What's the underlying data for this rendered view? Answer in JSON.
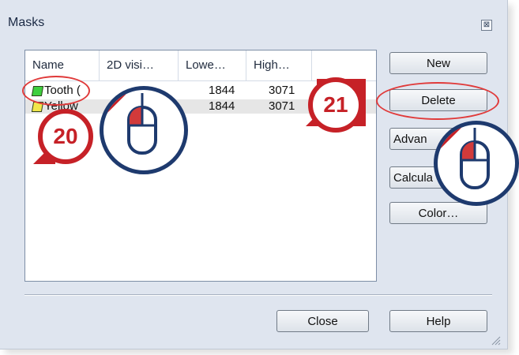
{
  "dialog": {
    "title": "Masks",
    "close_glyph": "⊠"
  },
  "table": {
    "headers": [
      "Name",
      "2D visi…",
      "Lowe…",
      "High…"
    ],
    "rows": [
      {
        "name": "Tooth (",
        "color": "#3ecf3e",
        "lower": "1844",
        "higher": "3071"
      },
      {
        "name": "Yellow",
        "color": "#f1e64a",
        "lower": "1844",
        "higher": "3071"
      }
    ]
  },
  "buttons": {
    "new": "New",
    "delete": "Delete",
    "advanced": "Advan",
    "calculate": "Calcula",
    "color": "Color…",
    "close": "Close",
    "help": "Help"
  },
  "callouts": {
    "step_a": "20",
    "step_b": "21"
  },
  "icons": {
    "mouse": "mouse-left-click-icon",
    "grip": "resize-grip-icon"
  },
  "colors": {
    "highlight": "#e03a3a",
    "badge": "#c62127",
    "mouse_outline": "#1e3a6e"
  }
}
